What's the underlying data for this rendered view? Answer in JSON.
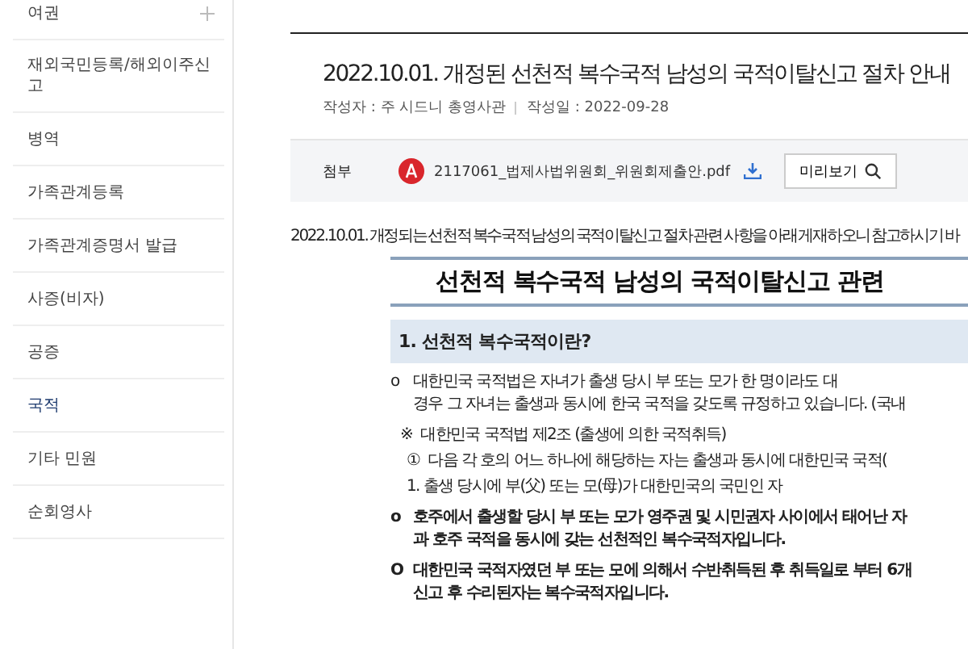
{
  "sidebar": {
    "items": [
      {
        "label": "여권",
        "selected": false,
        "has_submenu": true
      },
      {
        "label": "재외국민등록/해외이주신고",
        "selected": false,
        "has_submenu": false
      },
      {
        "label": "병역",
        "selected": false,
        "has_submenu": false
      },
      {
        "label": "가족관계등록",
        "selected": false,
        "has_submenu": false
      },
      {
        "label": "가족관계증명서 발급",
        "selected": false,
        "has_submenu": false
      },
      {
        "label": "사증(비자)",
        "selected": false,
        "has_submenu": false
      },
      {
        "label": "공증",
        "selected": false,
        "has_submenu": false
      },
      {
        "label": "국적",
        "selected": true,
        "has_submenu": false
      },
      {
        "label": "기타 민원",
        "selected": false,
        "has_submenu": false
      },
      {
        "label": "순회영사",
        "selected": false,
        "has_submenu": false
      }
    ]
  },
  "post": {
    "title": "2022.10.01. 개정된 선천적 복수국적 남성의 국적이탈신고 절차 안내",
    "author": "작성자 : 주 시드니 총영사관",
    "date": "작성일 : 2022-09-28",
    "attachment": {
      "label": "첨부",
      "filename": "2117061_법제사법위원회_위원회제출안.pdf",
      "preview_button": "미리보기"
    },
    "intro": "2022.10.01. 개정되는 선천적 복수국적 남성의 국적이탈신고 절차 관련 사항을 아래 게재하오니 참고하시기 바",
    "document": {
      "heading": "선천적 복수국적 남성의 국적이탈신고 관련",
      "section": "1. 선천적 복수국적이란?",
      "paragraphs": [
        {
          "kind": "bullet",
          "bold": false,
          "marker": "o",
          "lines": [
            "대한민국 국적법은 자녀가 출생 당시 부 또는 모가 한 명이라도 대",
            "경우 그 자녀는 출생과 동시에 한국 국적을 갖도록 규정하고 있습니다. (국내"
          ]
        },
        {
          "kind": "note",
          "bold": false,
          "marker": "※",
          "lines": [
            "대한민국 국적법 제2조 (출생에 의한 국적취득)"
          ]
        },
        {
          "kind": "clause",
          "bold": false,
          "marker": "①",
          "lines": [
            "다음 각 호의 어느 하나에 해당하는 자는 출생과 동시에 대한민국 국적("
          ]
        },
        {
          "kind": "clause",
          "bold": false,
          "lines": [
            "1. 출생 당시에 부(父) 또는 모(母)가 대한민국의 국민인 자"
          ]
        },
        {
          "kind": "bullet",
          "bold": true,
          "marker": "o",
          "lines": [
            "호주에서 출생할 당시 부 또는 모가 영주권 및 시민권자 사이에서 태어난 자",
            "과 호주 국적을 동시에 갖는 선천적인 복수국적자입니다."
          ]
        },
        {
          "kind": "bullet",
          "bold": true,
          "marker": "O",
          "lines": [
            "대한민국 국적자였던 부 또는 모에 의해서 수반취득된 후 취득일로 부터 6개",
            "신고 후 수리된자는 복수국적자입니다."
          ]
        }
      ]
    }
  }
}
